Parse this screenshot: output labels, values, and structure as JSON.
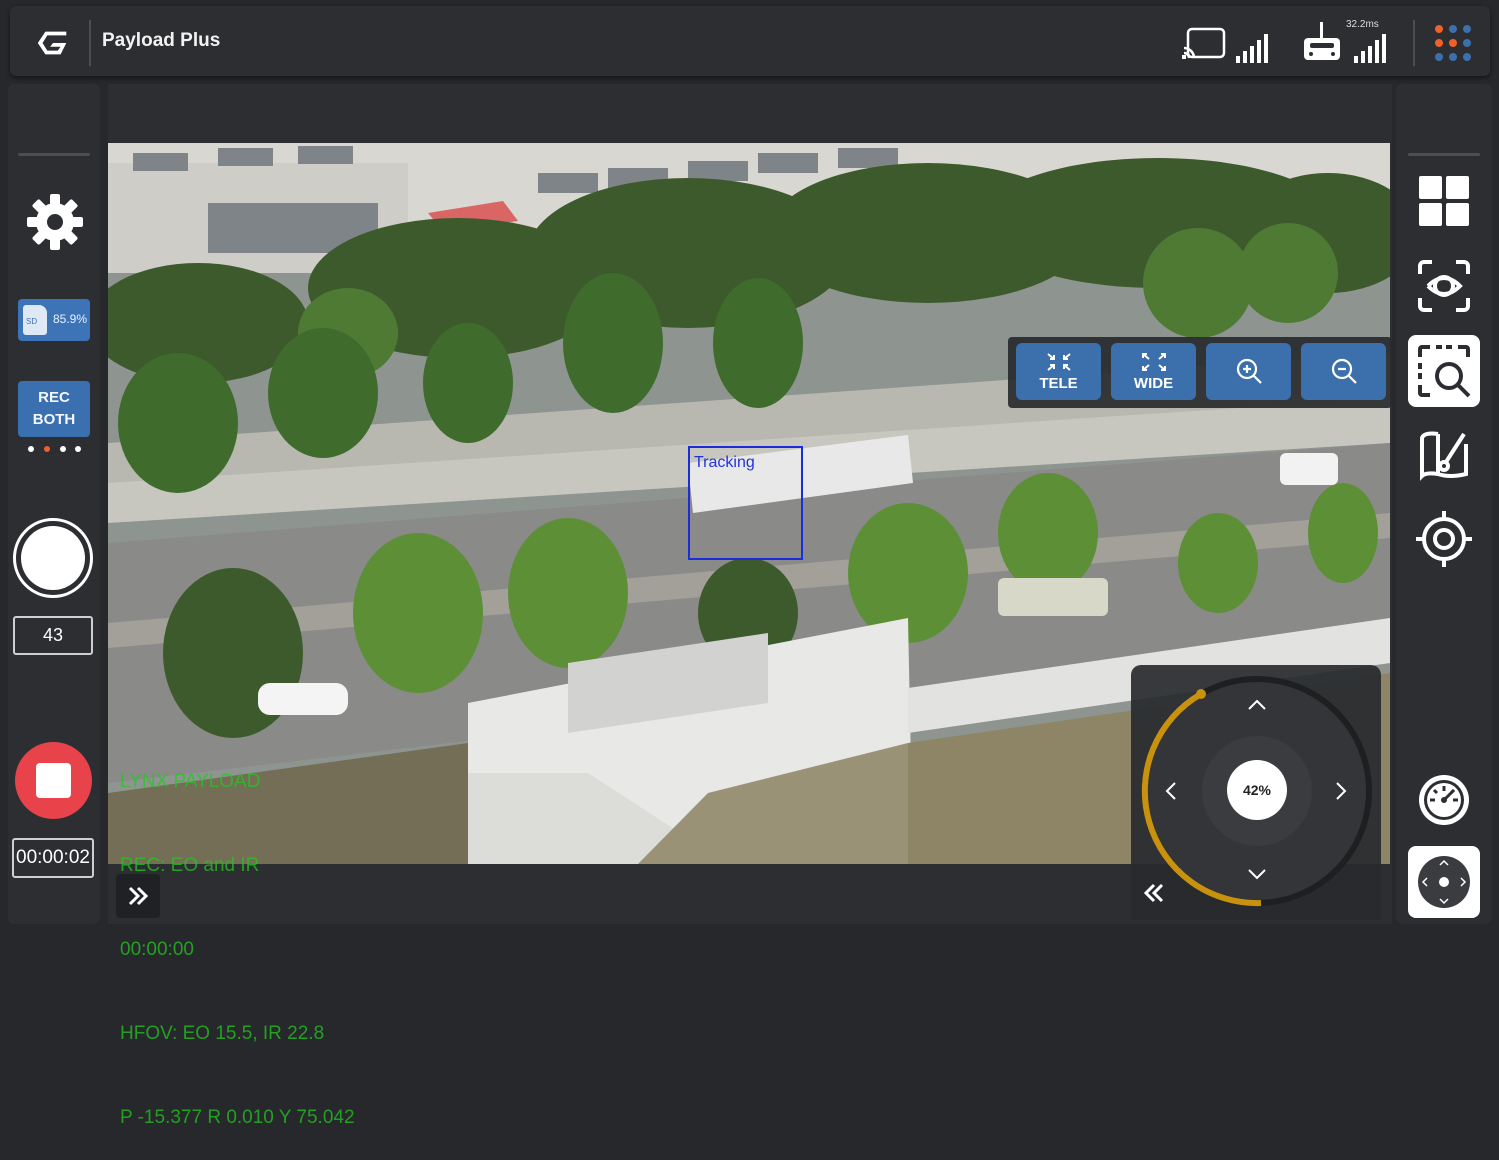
{
  "header": {
    "title": "Payload Plus",
    "latency": "32.2ms",
    "icons": [
      "logo-icon",
      "cast-icon",
      "signal-icon",
      "remote-controller-icon",
      "signal-icon",
      "apps-icon"
    ]
  },
  "left_panel": {
    "sd_percent": "85.9%",
    "sd_label": "SD",
    "rec_mode_line1": "REC",
    "rec_mode_line2": "BOTH",
    "photo_count": "43",
    "record_time": "00:00:02"
  },
  "zoom": {
    "tele_label": "TELE",
    "wide_label": "WIDE"
  },
  "tracking": {
    "label": "Tracking"
  },
  "osd": {
    "line1": "LYNX PAYLOAD",
    "line2": "REC: EO and IR",
    "line3": "00:00:00",
    "line4": "HFOV: EO 15.5, IR 22.8",
    "line5": "P -15.377 R 0.010 Y 75.042"
  },
  "gimbal": {
    "speed_percent": "42%"
  },
  "colors": {
    "accent_blue": "#3c70ad",
    "record_red": "#e8434a",
    "osd_green": "#23c81f",
    "tracking_blue": "#1a2ddd",
    "joystick_ring": "#c8920f"
  }
}
